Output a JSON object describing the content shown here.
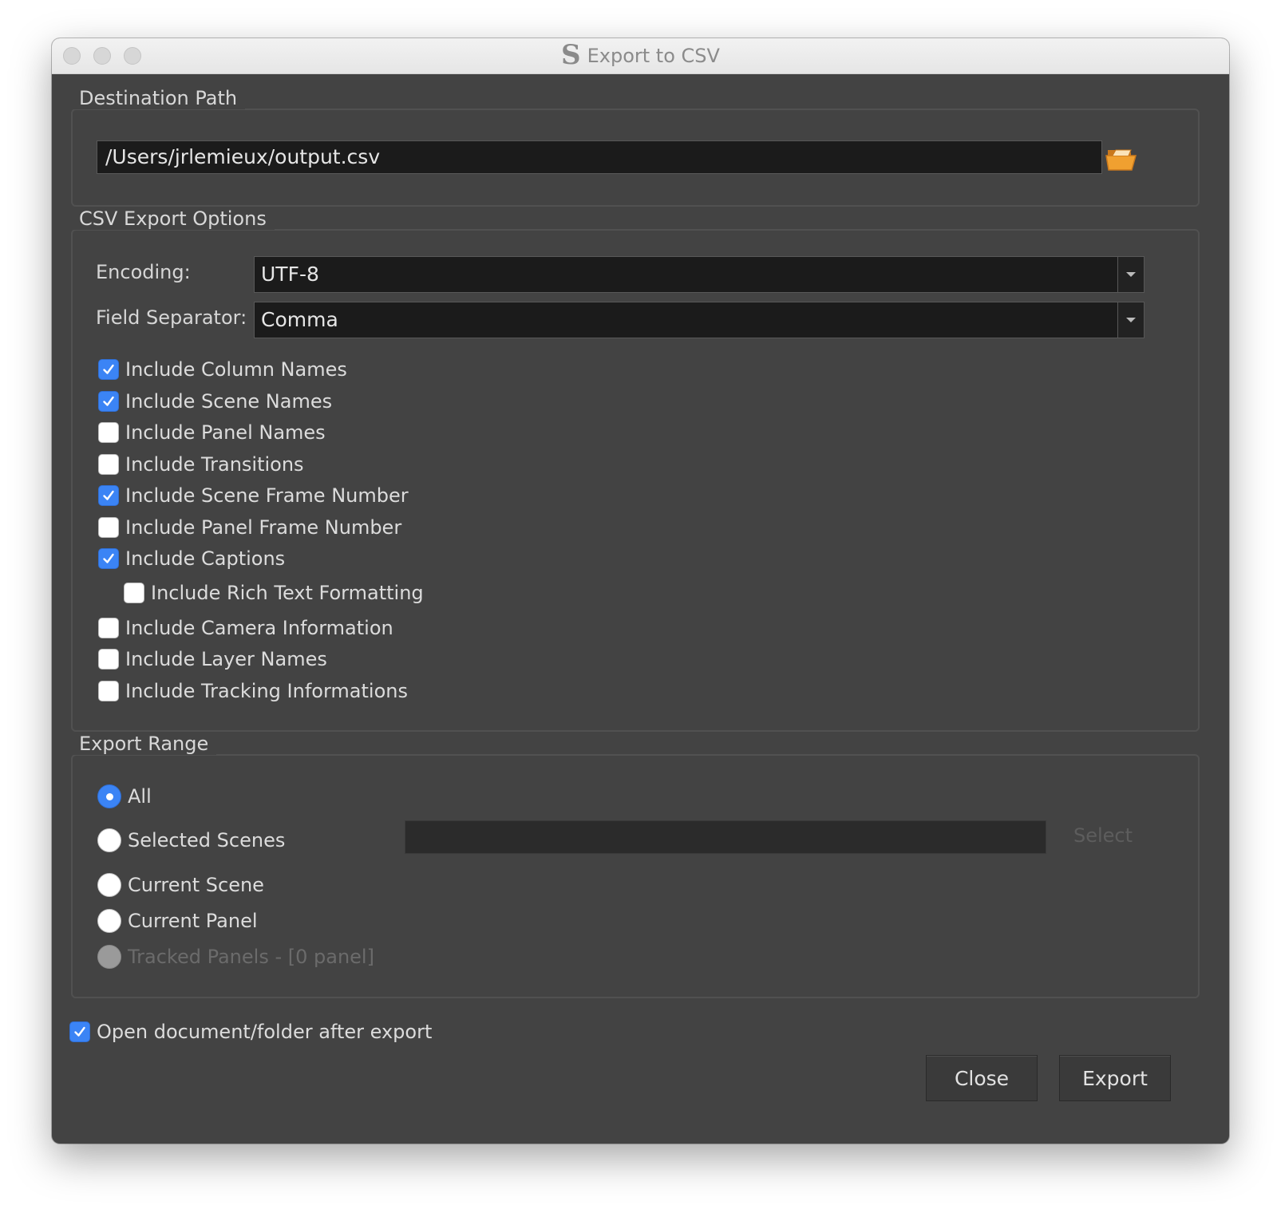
{
  "window": {
    "title": "Export to CSV",
    "app_icon": "S"
  },
  "destination": {
    "legend": "Destination Path",
    "path_value": "/Users/jrlemieux/output.csv",
    "browse_icon": "folder-open-icon"
  },
  "options": {
    "legend": "CSV Export Options",
    "encoding_label": "Encoding:",
    "encoding_value": "UTF-8",
    "separator_label": "Field Separator:",
    "separator_value": "Comma",
    "checkboxes": [
      {
        "label": "Include Column Names",
        "checked": true
      },
      {
        "label": "Include Scene Names",
        "checked": true
      },
      {
        "label": "Include Panel Names",
        "checked": false
      },
      {
        "label": "Include Transitions",
        "checked": false
      },
      {
        "label": "Include Scene Frame Number",
        "checked": true
      },
      {
        "label": "Include Panel Frame Number",
        "checked": false
      },
      {
        "label": "Include Captions",
        "checked": true
      },
      {
        "label": "Include Rich Text Formatting",
        "checked": false
      },
      {
        "label": "Include Camera Information",
        "checked": false
      },
      {
        "label": "Include Layer Names",
        "checked": false
      },
      {
        "label": "Include Tracking Informations",
        "checked": false
      }
    ]
  },
  "range": {
    "legend": "Export Range",
    "radios": [
      {
        "label": "All",
        "selected": true,
        "disabled": false
      },
      {
        "label": "Selected Scenes",
        "selected": false,
        "disabled": false
      },
      {
        "label": "Current Scene",
        "selected": false,
        "disabled": false
      },
      {
        "label": "Current Panel",
        "selected": false,
        "disabled": false
      },
      {
        "label": "Tracked Panels - [0 panel]",
        "selected": false,
        "disabled": true
      }
    ],
    "selected_scenes_value": "",
    "select_button": "Select"
  },
  "footer": {
    "open_after_label": "Open document/folder after export",
    "open_after_checked": true,
    "close_button": "Close",
    "export_button": "Export"
  },
  "colors": {
    "accent": "#3b84f5",
    "panel_bg": "#434343",
    "field_bg": "#1b1b1b",
    "folder_icon": "#f0a030"
  }
}
